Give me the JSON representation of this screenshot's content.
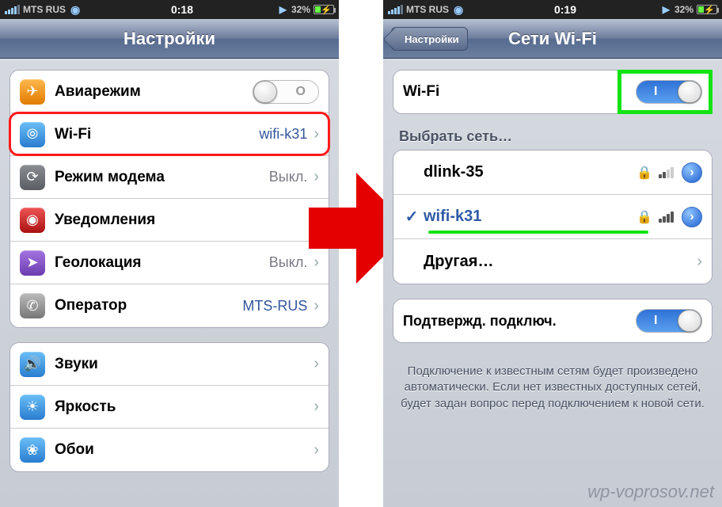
{
  "left": {
    "status": {
      "carrier": "MTS RUS",
      "time": "0:18",
      "battery": "32%"
    },
    "nav_title": "Настройки",
    "rows": {
      "airplane": "Авиарежим",
      "wifi": "Wi-Fi",
      "wifi_value": "wifi-k31",
      "hotspot": "Режим модема",
      "hotspot_value": "Выкл.",
      "notif": "Уведомления",
      "loc": "Геолокация",
      "loc_value": "Выкл.",
      "carrier": "Оператор",
      "carrier_value": "MTS-RUS",
      "sound": "Звуки",
      "bright": "Яркость",
      "wall": "Обои"
    }
  },
  "right": {
    "status": {
      "carrier": "MTS RUS",
      "time": "0:19",
      "battery": "32%"
    },
    "nav_back": "Настройки",
    "nav_title": "Сети Wi-Fi",
    "wifi_label": "Wi-Fi",
    "section": "Выбрать сеть…",
    "net1": "dlink-35",
    "net2": "wifi-k31",
    "other": "Другая…",
    "ask_label": "Подтвержд. подключ.",
    "footer": "Подключение к известным сетям будет произведено автоматически. Если нет известных доступных сетей, будет задан вопрос перед подключением к новой сети."
  },
  "watermark": "wp-voprosov.net"
}
